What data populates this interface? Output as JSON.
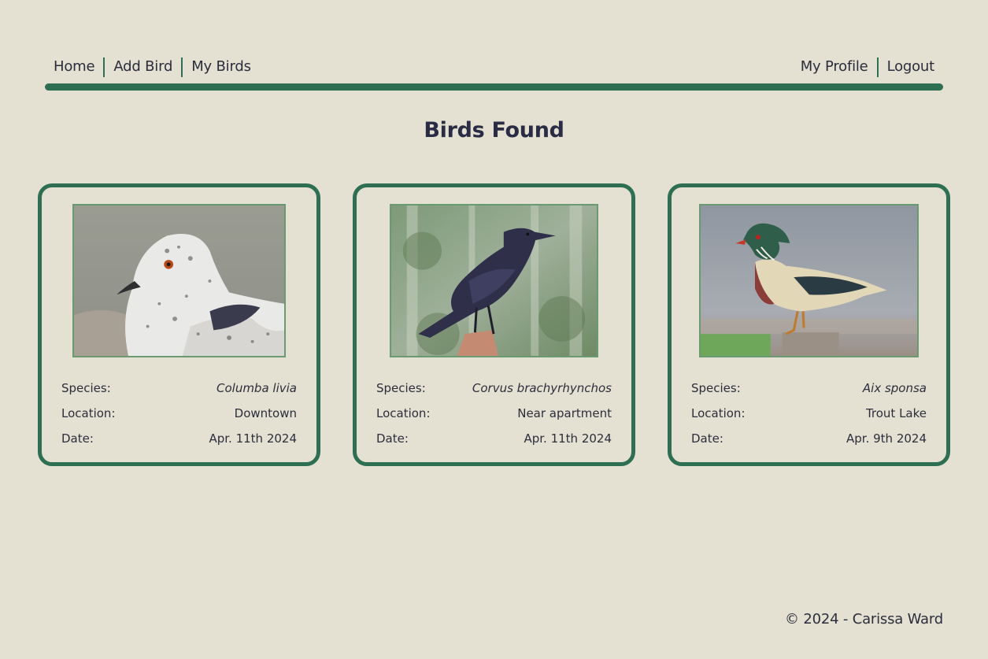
{
  "nav": {
    "left": [
      "Home",
      "Add Bird",
      "My Birds"
    ],
    "right": [
      "My Profile",
      "Logout"
    ]
  },
  "page": {
    "title": "Birds Found"
  },
  "labels": {
    "species": "Species:",
    "location": "Location:",
    "date": "Date:"
  },
  "cards": [
    {
      "species": "Columba livia",
      "location": "Downtown",
      "date": "Apr. 11th 2024",
      "photo_icon": "pigeon-photo"
    },
    {
      "species": "Corvus brachyrhynchos",
      "location": "Near apartment",
      "date": "Apr. 11th 2024",
      "photo_icon": "crow-photo"
    },
    {
      "species": "Aix sponsa",
      "location": "Trout Lake",
      "date": "Apr. 9th 2024",
      "photo_icon": "wood-duck-photo"
    }
  ],
  "footer": {
    "text": "© 2024 - Carissa Ward"
  },
  "colors": {
    "background": "#e4e1d2",
    "accent": "#2e6e52",
    "title": "#2a2b45"
  }
}
